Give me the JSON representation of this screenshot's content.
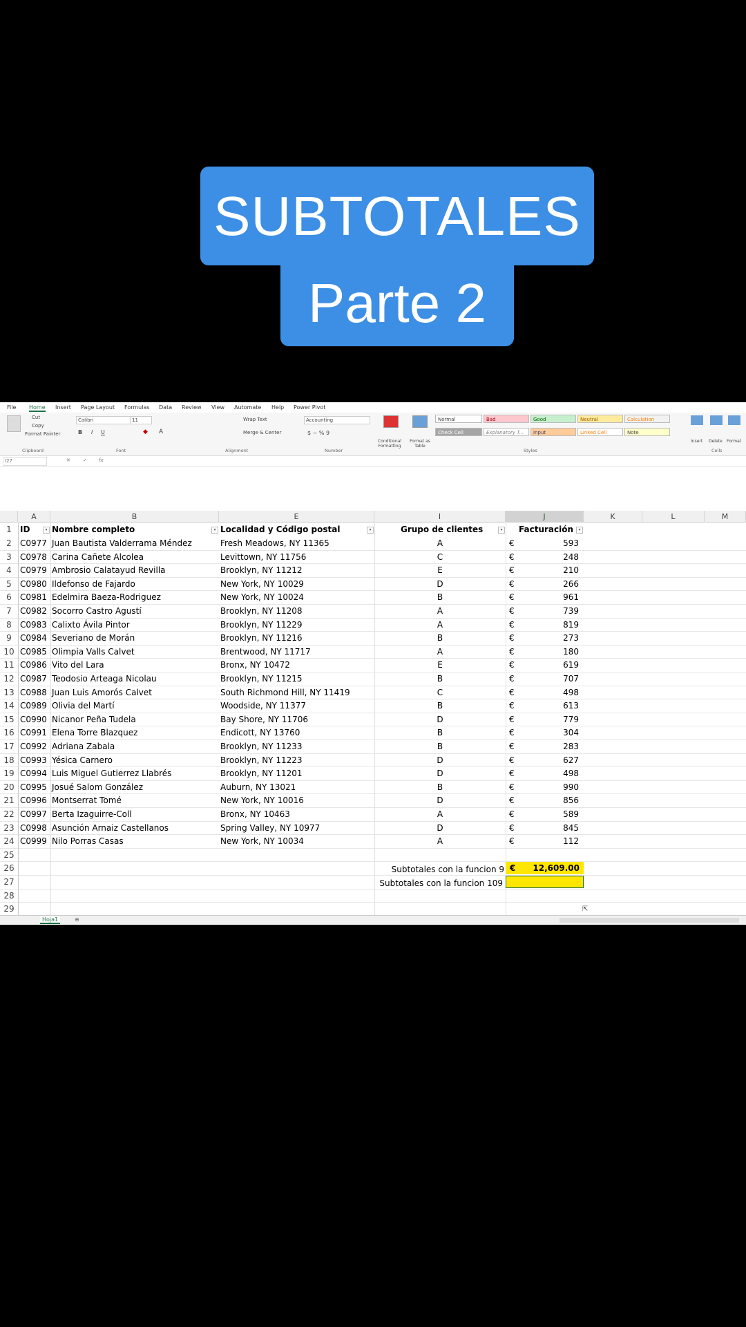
{
  "overlay": {
    "title_line1": "SUBTOTALES",
    "title_line2": "Parte 2"
  },
  "menu": [
    "File",
    "Home",
    "Insert",
    "Page Layout",
    "Formulas",
    "Data",
    "Review",
    "View",
    "Automate",
    "Help",
    "Power Pivot"
  ],
  "ribbon": {
    "cut": "Cut",
    "copy": "Copy",
    "format_painter": "Format Painter",
    "font": "Calibri",
    "size": "11",
    "wrap_text": "Wrap Text",
    "merge_center": "Merge & Center",
    "number_format": "Accounting",
    "conditional_formatting": "Conditional Formatting",
    "format_as_table": "Format as Table",
    "styles": [
      "Normal",
      "Bad",
      "Good",
      "Neutral",
      "Calculation",
      "Check Cell",
      "Explanatory T...",
      "Input",
      "Linked Cell",
      "Note"
    ],
    "insert": "Insert",
    "delete": "Delete",
    "format": "Format",
    "groups": {
      "clipboard": "Clipboard",
      "font": "Font",
      "alignment": "Alignment",
      "number": "Number",
      "styles": "Styles",
      "cells": "Cells"
    }
  },
  "name_box": "I27",
  "columns": [
    "A",
    "B",
    "E",
    "I",
    "J",
    "K",
    "L",
    "M"
  ],
  "headers": {
    "id": "ID",
    "name": "Nombre completo",
    "loc": "Localidad y Código postal",
    "grp": "Grupo de clientes",
    "fac": "Facturación"
  },
  "currency": "€",
  "rows": [
    {
      "n": "2",
      "id": "C0977",
      "name": "Juan Bautista Valderrama Méndez",
      "loc": "Fresh Meadows, NY 11365",
      "grp": "A",
      "amt": "593"
    },
    {
      "n": "3",
      "id": "C0978",
      "name": "Carina Cañete Alcolea",
      "loc": "Levittown, NY 11756",
      "grp": "C",
      "amt": "248"
    },
    {
      "n": "4",
      "id": "C0979",
      "name": "Ambrosio Calatayud Revilla",
      "loc": "Brooklyn, NY 11212",
      "grp": "E",
      "amt": "210"
    },
    {
      "n": "5",
      "id": "C0980",
      "name": "Ildefonso de Fajardo",
      "loc": "New York, NY 10029",
      "grp": "D",
      "amt": "266"
    },
    {
      "n": "6",
      "id": "C0981",
      "name": "Edelmira Baeza-Rodriguez",
      "loc": "New York, NY 10024",
      "grp": "B",
      "amt": "961"
    },
    {
      "n": "7",
      "id": "C0982",
      "name": "Socorro Castro Agustí",
      "loc": "Brooklyn, NY 11208",
      "grp": "A",
      "amt": "739"
    },
    {
      "n": "8",
      "id": "C0983",
      "name": "Calixto Ávila Pintor",
      "loc": "Brooklyn, NY 11229",
      "grp": "A",
      "amt": "819"
    },
    {
      "n": "9",
      "id": "C0984",
      "name": "Severiano de Morán",
      "loc": "Brooklyn, NY 11216",
      "grp": "B",
      "amt": "273"
    },
    {
      "n": "10",
      "id": "C0985",
      "name": "Olimpia Valls Calvet",
      "loc": "Brentwood, NY 11717",
      "grp": "A",
      "amt": "180"
    },
    {
      "n": "11",
      "id": "C0986",
      "name": "Vito del Lara",
      "loc": "Bronx, NY 10472",
      "grp": "E",
      "amt": "619"
    },
    {
      "n": "12",
      "id": "C0987",
      "name": "Teodosio Arteaga Nicolau",
      "loc": "Brooklyn, NY 11215",
      "grp": "B",
      "amt": "707"
    },
    {
      "n": "13",
      "id": "C0988",
      "name": "Juan Luis Amorós Calvet",
      "loc": "South Richmond Hill, NY 11419",
      "grp": "C",
      "amt": "498"
    },
    {
      "n": "14",
      "id": "C0989",
      "name": "Olivia del Martí",
      "loc": "Woodside, NY 11377",
      "grp": "B",
      "amt": "613"
    },
    {
      "n": "15",
      "id": "C0990",
      "name": "Nicanor Peña Tudela",
      "loc": "Bay Shore, NY 11706",
      "grp": "D",
      "amt": "779"
    },
    {
      "n": "16",
      "id": "C0991",
      "name": "Elena Torre Blazquez",
      "loc": "Endicott, NY 13760",
      "grp": "B",
      "amt": "304"
    },
    {
      "n": "17",
      "id": "C0992",
      "name": "Adriana Zabala",
      "loc": "Brooklyn, NY 11233",
      "grp": "B",
      "amt": "283"
    },
    {
      "n": "18",
      "id": "C0993",
      "name": "Yésica Carnero",
      "loc": "Brooklyn, NY 11223",
      "grp": "D",
      "amt": "627"
    },
    {
      "n": "19",
      "id": "C0994",
      "name": "Luis Miguel Gutierrez Llabrés",
      "loc": "Brooklyn, NY 11201",
      "grp": "D",
      "amt": "498"
    },
    {
      "n": "20",
      "id": "C0995",
      "name": "Josué Salom González",
      "loc": "Auburn, NY 13021",
      "grp": "B",
      "amt": "990"
    },
    {
      "n": "21",
      "id": "C0996",
      "name": "Montserrat Tomé",
      "loc": "New York, NY 10016",
      "grp": "D",
      "amt": "856"
    },
    {
      "n": "22",
      "id": "C0997",
      "name": "Berta Izaguirre-Coll",
      "loc": "Bronx, NY 10463",
      "grp": "A",
      "amt": "589"
    },
    {
      "n": "23",
      "id": "C0998",
      "name": "Asunción Arnaiz Castellanos",
      "loc": "Spring Valley, NY 10977",
      "grp": "D",
      "amt": "845"
    },
    {
      "n": "24",
      "id": "C0999",
      "name": "Nilo Porras Casas",
      "loc": "New York, NY 10034",
      "grp": "A",
      "amt": "112"
    }
  ],
  "extra_rows": [
    "25",
    "26",
    "27",
    "28",
    "29"
  ],
  "subtotals": {
    "label9": "Subtotales con la funcion 9",
    "value9": "12,609.00",
    "label109": "Subtotales con la funcion 109"
  },
  "sheet_tab": "Hoja1",
  "colors": {
    "title_bg": "#3d8fe6",
    "highlight": "#ffe600",
    "excel_green": "#1e7145"
  }
}
